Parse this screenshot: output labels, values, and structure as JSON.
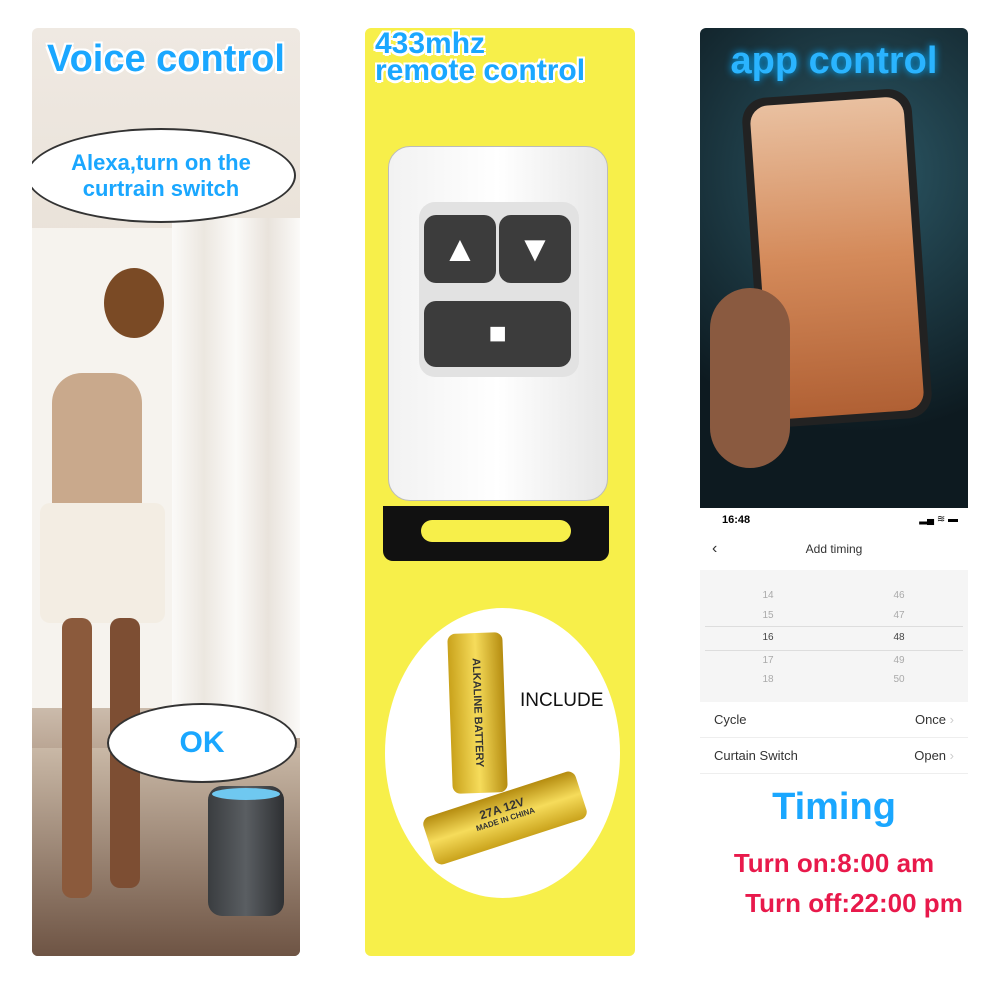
{
  "voice_panel": {
    "title": "Voice control",
    "bubble_top": "Alexa,turn on the curtrain switch",
    "bubble_bottom": "OK"
  },
  "remote_panel": {
    "title_line1": "433mhz",
    "title_line2": "remote control",
    "include_label": "INCLUDE",
    "battery_text": "ALKALINE BATTERY",
    "battery_spec": "27A 12V",
    "battery_made": "MADE IN CHINA",
    "buttons": [
      "up-arrow-icon",
      "down-arrow-icon",
      "stop-icon"
    ]
  },
  "app_panel": {
    "title": "app control",
    "status_time": "16:48",
    "header_title": "Add timing",
    "hours": [
      "14",
      "15",
      "16",
      "17",
      "18"
    ],
    "minutes": [
      "46",
      "47",
      "48",
      "49",
      "50"
    ],
    "rows": [
      {
        "label": "Cycle",
        "value": "Once"
      },
      {
        "label": "Curtain Switch",
        "value": "Open"
      }
    ],
    "timing_title": "Timing",
    "turn_on": "Turn on:8:00 am",
    "turn_off": "Turn off:22:00 pm"
  },
  "colors": {
    "title_blue": "#1aa7ff",
    "panel_yellow": "#f7ef4a",
    "timing_red": "#e8194b"
  }
}
